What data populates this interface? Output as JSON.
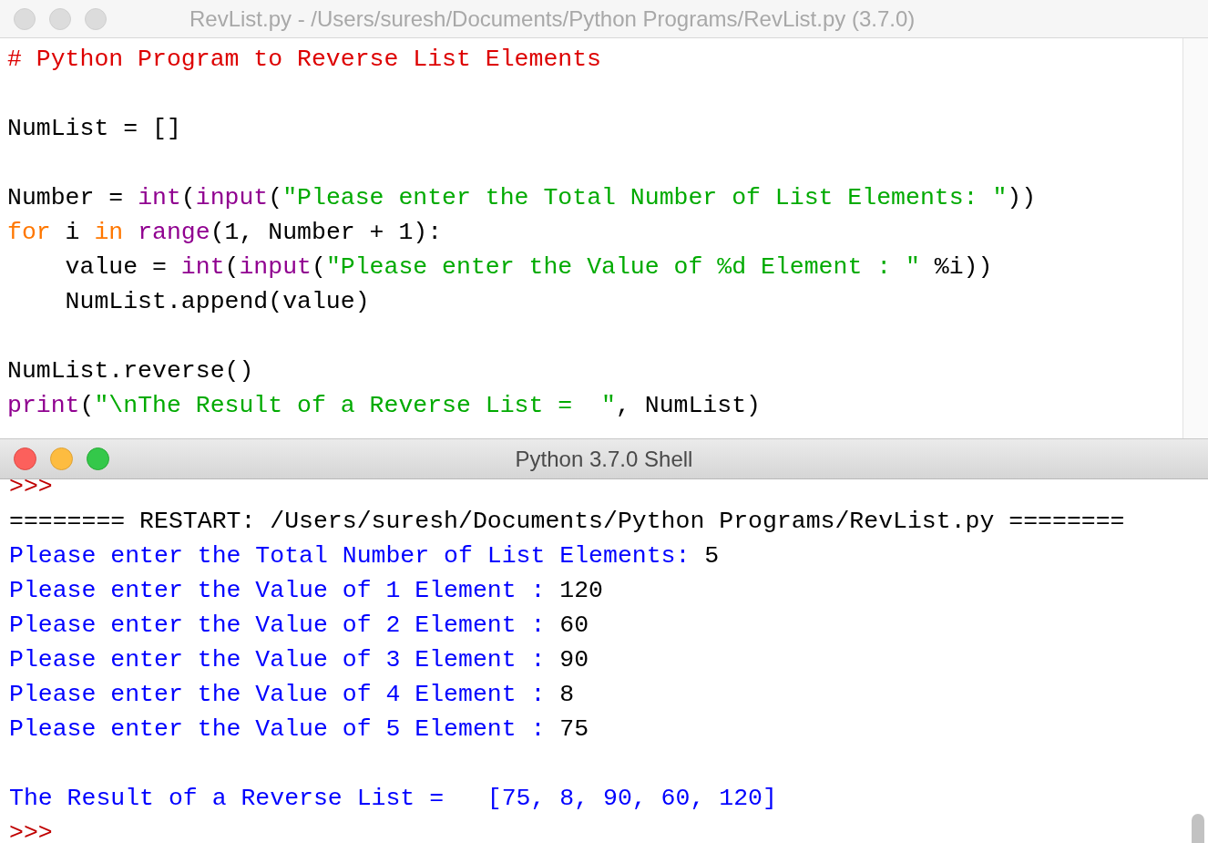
{
  "editor": {
    "title": "RevList.py - /Users/suresh/Documents/Python Programs/RevList.py (3.7.0)",
    "lines": [
      {
        "kind": "code",
        "tokens": [
          {
            "text": "# Python Program to Reverse List Elements",
            "kind": "comment"
          }
        ]
      },
      {
        "kind": "blank"
      },
      {
        "kind": "code",
        "tokens": [
          {
            "text": "NumList = []",
            "kind": "plain"
          }
        ]
      },
      {
        "kind": "blank"
      },
      {
        "kind": "code",
        "tokens": [
          {
            "text": "Number = ",
            "kind": "plain"
          },
          {
            "text": "int",
            "kind": "builtin"
          },
          {
            "text": "(",
            "kind": "plain"
          },
          {
            "text": "input",
            "kind": "builtin"
          },
          {
            "text": "(",
            "kind": "plain"
          },
          {
            "text": "\"Please enter the Total Number of List Elements: \"",
            "kind": "string"
          },
          {
            "text": "))",
            "kind": "plain"
          }
        ]
      },
      {
        "kind": "code",
        "tokens": [
          {
            "text": "for",
            "kind": "keyword"
          },
          {
            "text": " i ",
            "kind": "plain"
          },
          {
            "text": "in",
            "kind": "keyword"
          },
          {
            "text": " range",
            "kind": "builtin"
          },
          {
            "text": "(1, Number + 1):",
            "kind": "plain"
          }
        ]
      },
      {
        "kind": "code",
        "tokens": [
          {
            "text": "    value = ",
            "kind": "plain"
          },
          {
            "text": "int",
            "kind": "builtin"
          },
          {
            "text": "(",
            "kind": "plain"
          },
          {
            "text": "input",
            "kind": "builtin"
          },
          {
            "text": "(",
            "kind": "plain"
          },
          {
            "text": "\"Please enter the Value of %d Element : \"",
            "kind": "string"
          },
          {
            "text": " %i))",
            "kind": "plain"
          }
        ]
      },
      {
        "kind": "code",
        "tokens": [
          {
            "text": "    NumList.append(value)",
            "kind": "plain"
          }
        ]
      },
      {
        "kind": "blank"
      },
      {
        "kind": "code",
        "tokens": [
          {
            "text": "NumList.reverse()",
            "kind": "plain"
          }
        ]
      },
      {
        "kind": "code",
        "tokens": [
          {
            "text": "print",
            "kind": "builtin"
          },
          {
            "text": "(",
            "kind": "plain"
          },
          {
            "text": "\"\\nThe Result of a Reverse List =  \"",
            "kind": "string"
          },
          {
            "text": ", NumList)",
            "kind": "plain"
          }
        ]
      }
    ]
  },
  "shell": {
    "title": "Python 3.7.0 Shell",
    "lines": [
      {
        "kind": "code",
        "tokens": [
          {
            "text": ">>>",
            "kind": "prompt"
          }
        ]
      },
      {
        "kind": "code",
        "tokens": [
          {
            "text": "======== RESTART: /Users/suresh/Documents/Python Programs/RevList.py ========",
            "kind": "plain"
          }
        ]
      },
      {
        "kind": "code",
        "tokens": [
          {
            "text": "Please enter the Total Number of List Elements: ",
            "kind": "output"
          },
          {
            "text": "5",
            "kind": "plain"
          }
        ]
      },
      {
        "kind": "code",
        "tokens": [
          {
            "text": "Please enter the Value of 1 Element : ",
            "kind": "output"
          },
          {
            "text": "120",
            "kind": "plain"
          }
        ]
      },
      {
        "kind": "code",
        "tokens": [
          {
            "text": "Please enter the Value of 2 Element : ",
            "kind": "output"
          },
          {
            "text": "60",
            "kind": "plain"
          }
        ]
      },
      {
        "kind": "code",
        "tokens": [
          {
            "text": "Please enter the Value of 3 Element : ",
            "kind": "output"
          },
          {
            "text": "90",
            "kind": "plain"
          }
        ]
      },
      {
        "kind": "code",
        "tokens": [
          {
            "text": "Please enter the Value of 4 Element : ",
            "kind": "output"
          },
          {
            "text": "8",
            "kind": "plain"
          }
        ]
      },
      {
        "kind": "code",
        "tokens": [
          {
            "text": "Please enter the Value of 5 Element : ",
            "kind": "output"
          },
          {
            "text": "75",
            "kind": "plain"
          }
        ]
      },
      {
        "kind": "blank"
      },
      {
        "kind": "code",
        "tokens": [
          {
            "text": "The Result of a Reverse List =   [75, 8, 90, 60, 120]",
            "kind": "output"
          }
        ]
      },
      {
        "kind": "code",
        "tokens": [
          {
            "text": ">>>",
            "kind": "prompt"
          }
        ]
      }
    ]
  }
}
